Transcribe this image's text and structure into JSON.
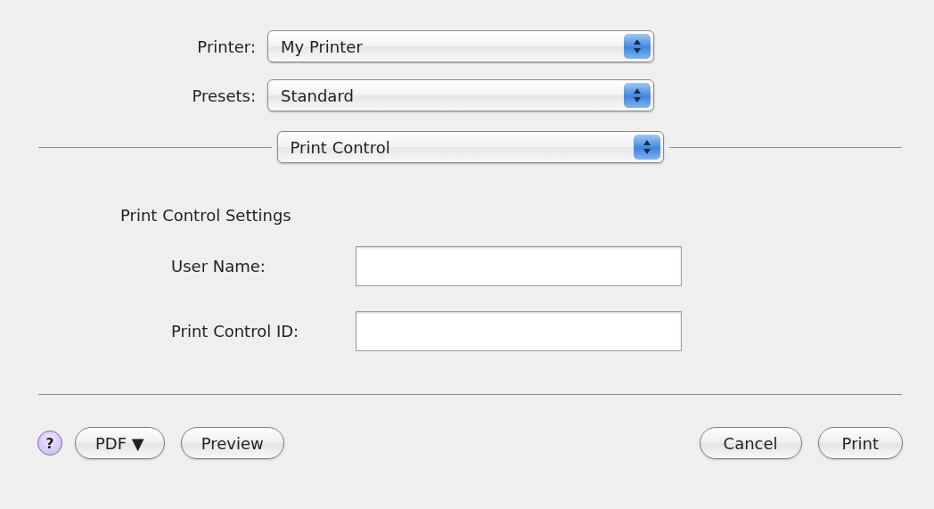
{
  "popups": [
    {
      "label": "Printer:",
      "value": "My Printer"
    },
    {
      "label": "Presets:",
      "value": "Standard"
    }
  ],
  "panel_popup": {
    "value": "Print Control"
  },
  "section": {
    "title": "Print Control Settings",
    "fields": [
      {
        "label": "User Name:"
      },
      {
        "label": "Print Control ID:"
      }
    ]
  },
  "help_button": {
    "text": "?"
  },
  "left_buttons": [
    {
      "text": "PDF ▼"
    },
    {
      "text": "Preview"
    }
  ],
  "right_buttons": [
    {
      "text": "Cancel"
    },
    {
      "text": "Print"
    }
  ]
}
